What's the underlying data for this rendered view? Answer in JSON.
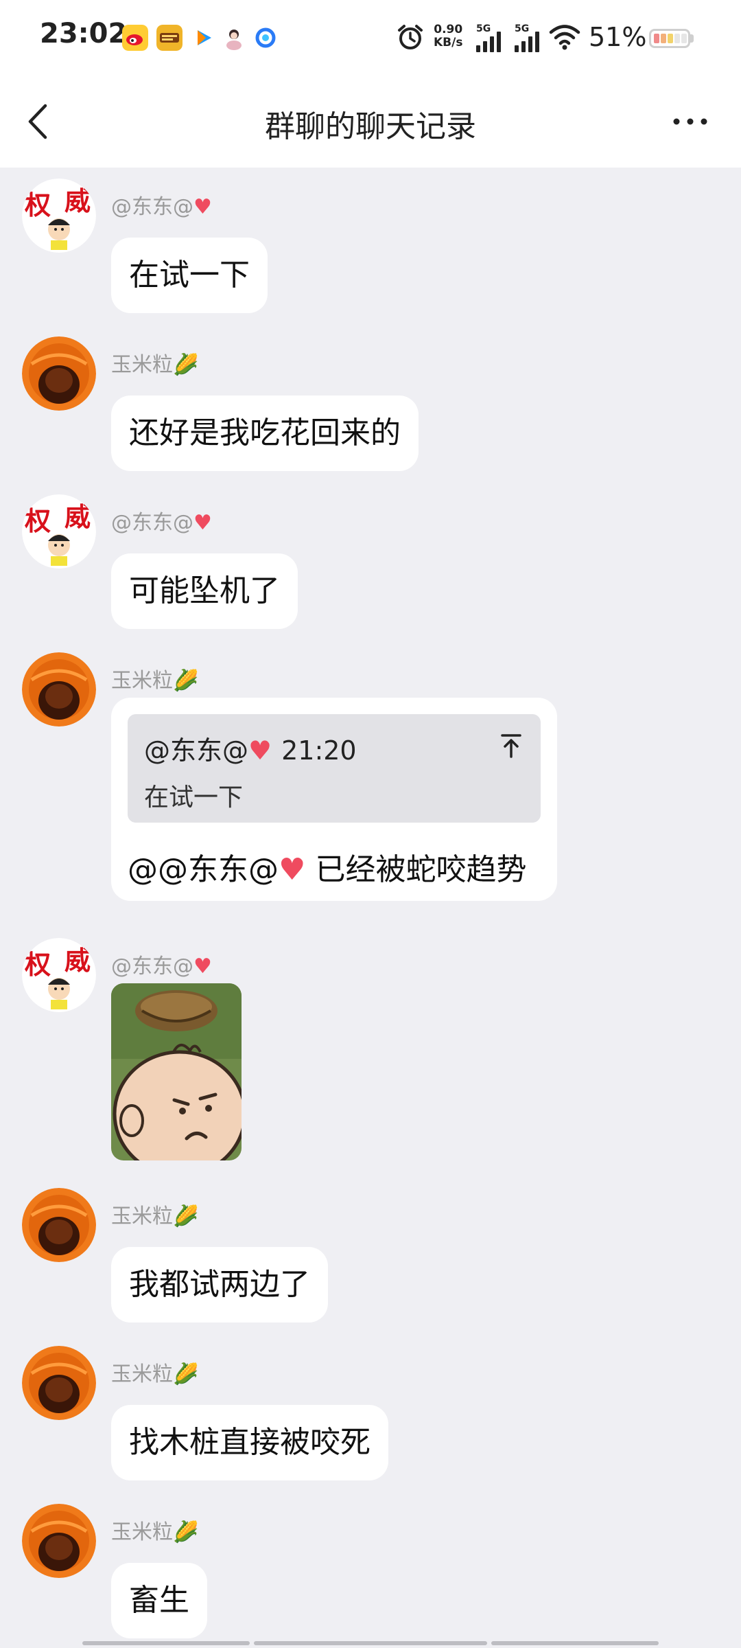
{
  "status": {
    "time": "23:02",
    "speed_value": "0.90",
    "speed_unit": "KB/s",
    "network1": "5G",
    "network2": "5G",
    "battery": "51%",
    "app_icons": [
      "weibo-icon",
      "game-icon",
      "video-icon",
      "avatar-app-icon",
      "browser-icon"
    ]
  },
  "header": {
    "title": "群聊的聊天记录"
  },
  "messages": [
    {
      "sender": "@东东@",
      "sender_emoji": "♥",
      "text": "在试一下"
    },
    {
      "sender": "玉米粒",
      "sender_emoji": "🌽",
      "text": "还好是我吃花回来的"
    },
    {
      "sender": "@东东@",
      "sender_emoji": "♥",
      "text": "可能坠机了"
    },
    {
      "sender": "玉米粒",
      "sender_emoji": "🌽",
      "quote": {
        "author": "@东东@",
        "author_emoji": "♥",
        "time": "21:20",
        "text": "在试一下"
      },
      "text": "@@东东@",
      "text_emoji": "♥",
      "text_tail": " 已经被蛇咬趋势"
    },
    {
      "sender": "@东东@",
      "sender_emoji": "♥",
      "type": "sticker"
    },
    {
      "sender": "玉米粒",
      "sender_emoji": "🌽",
      "text": "我都试两边了"
    },
    {
      "sender": "玉米粒",
      "sender_emoji": "🌽",
      "text": "找木桩直接被咬死"
    },
    {
      "sender": "玉米粒",
      "sender_emoji": "🌽",
      "text": "畜生"
    }
  ],
  "colors": {
    "background": "#efeff3",
    "bubble": "#ffffff",
    "quote_box": "#e2e2e6",
    "heart": "#ef4b5f"
  }
}
